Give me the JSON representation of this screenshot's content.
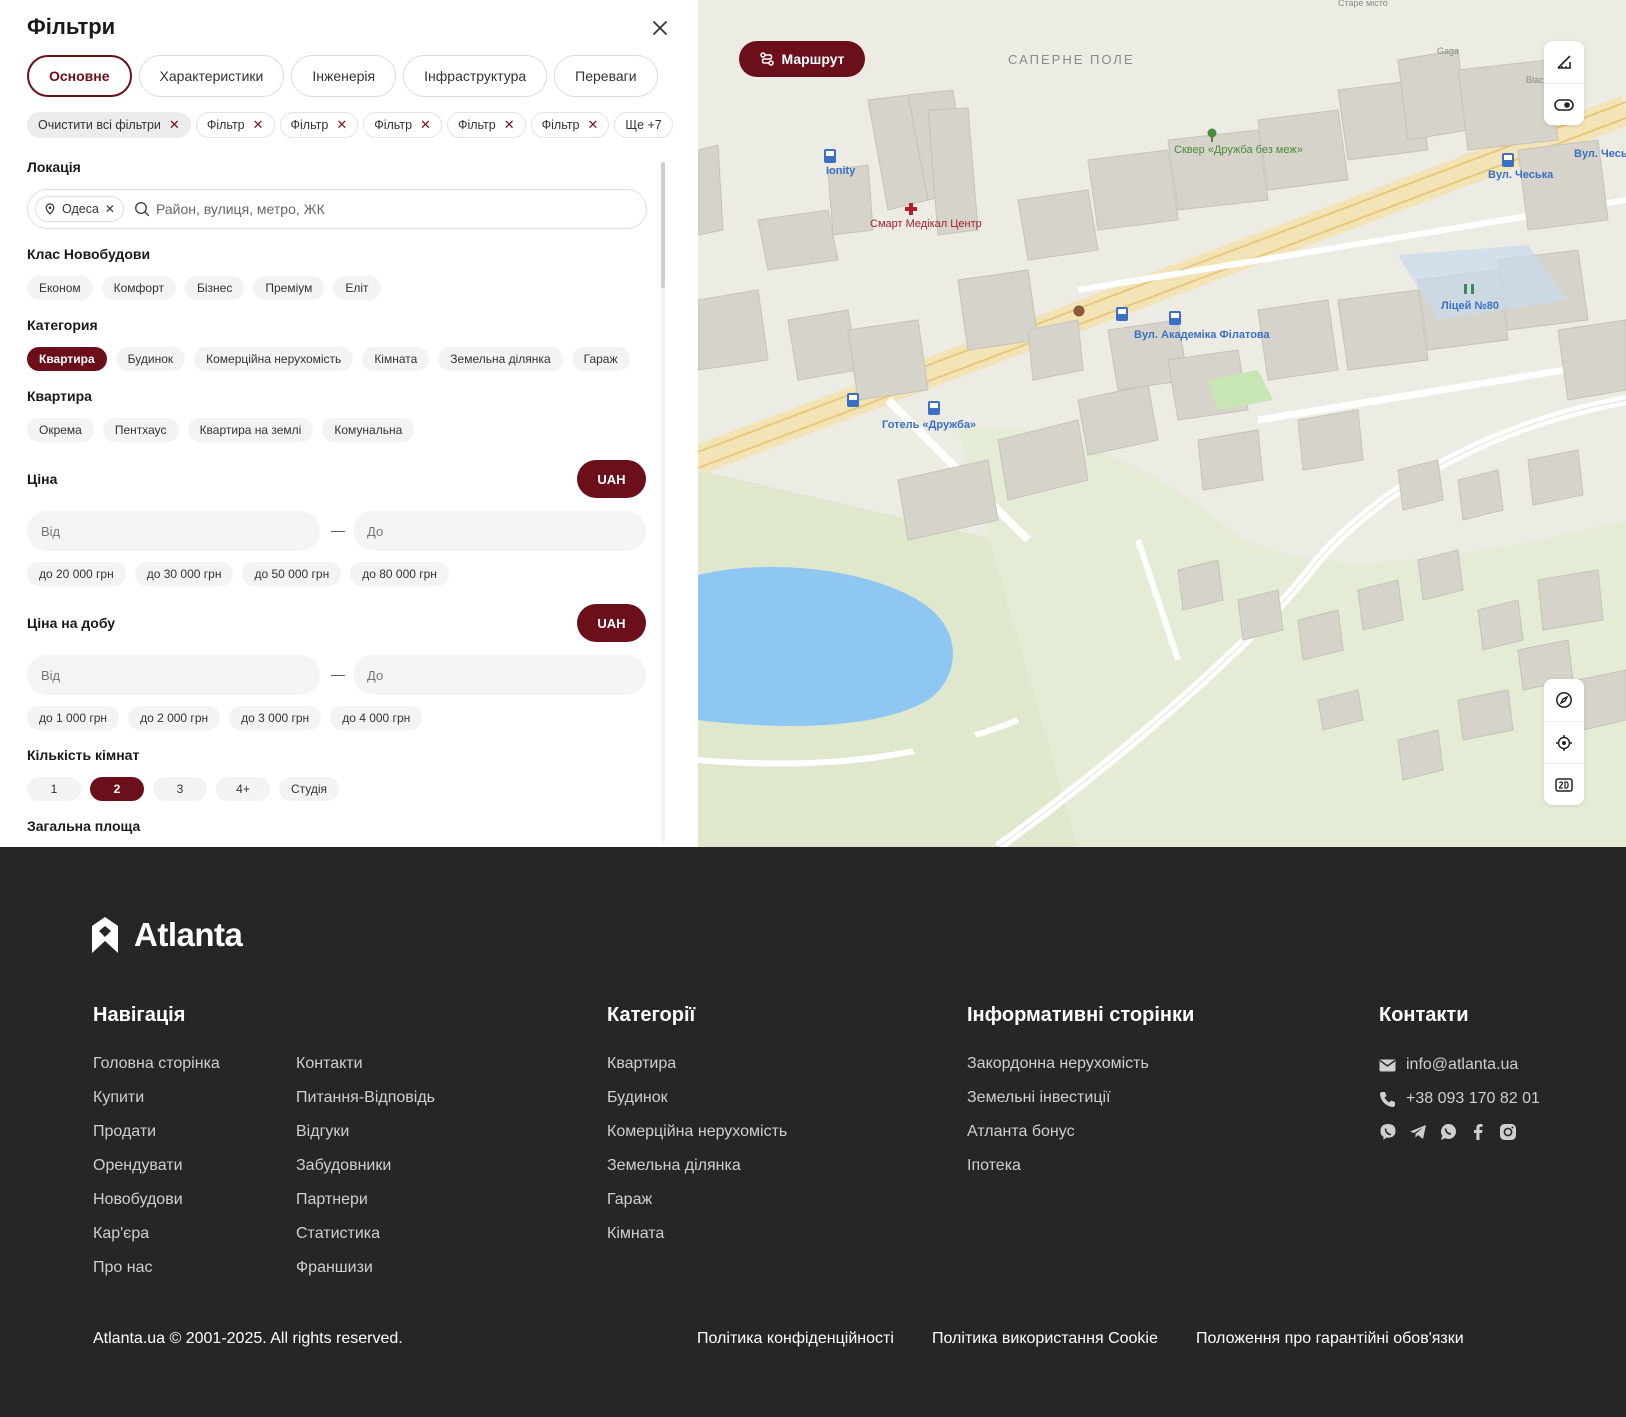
{
  "filters": {
    "title": "Фільтри",
    "tabs": [
      "Основне",
      "Характеристики",
      "Інженерія",
      "Інфраструктура",
      "Переваги"
    ],
    "chips": {
      "clear": "Очистити всі фільтри",
      "items": [
        "Фільтр",
        "Фільтр",
        "Фільтр",
        "Фільтр",
        "Фільтр"
      ],
      "more": "Ще +7"
    },
    "location": {
      "label": "Локація",
      "city": "Одеса",
      "placeholder": "Район, вулиця, метро, ЖК"
    },
    "class": {
      "label": "Клас Новобудови",
      "options": [
        "Економ",
        "Комфорт",
        "Бізнес",
        "Преміум",
        "Еліт"
      ]
    },
    "category": {
      "label": "Категория",
      "options": [
        "Квартира",
        "Будинок",
        "Комерційна нерухомість",
        "Кімната",
        "Земельна ділянка",
        "Гараж"
      ],
      "selected": "Квартира"
    },
    "apartment": {
      "label": "Квартира",
      "options": [
        "Окрема",
        "Пентхаус",
        "Квартира на землі",
        "Комунальна"
      ]
    },
    "price": {
      "label": "Ціна",
      "currency": "UAH",
      "from_placeholder": "Від",
      "to_placeholder": "До",
      "presets": [
        "до 20 000 грн",
        "до 30 000 грн",
        "до 50 000 грн",
        "до 80 000 грн"
      ]
    },
    "daily_price": {
      "label": "Ціна на добу",
      "currency": "UAH",
      "from_placeholder": "Від",
      "to_placeholder": "До",
      "presets": [
        "до 1 000 грн",
        "до 2 000 грн",
        "до 3 000 грн",
        "до 4 000 грн"
      ]
    },
    "rooms": {
      "label": "Кількість кімнат",
      "options": [
        "1",
        "2",
        "3",
        "4+",
        "Студія"
      ],
      "selected": "2"
    },
    "area": {
      "label": "Загальна площа"
    },
    "dash": "—"
  },
  "map": {
    "route_label": "Маршрут",
    "labels": {
      "district": "САПЕРНЕ ПОЛЕ",
      "ionity": "Ionity",
      "clinic": "Смарт Медікал Центр",
      "square": "Сквер «Дружба без меж»",
      "lyceum": "Ліцей №80",
      "stop1": "Вул. Академіка Філатова",
      "hotel": "Готель «Дружба»",
      "stop2": "Вул. Чеська",
      "stop3": "Вул. Чеськ",
      "gaga": "Gaga",
      "old_city": "Старе місто",
      "blac": "Blac"
    }
  },
  "footer": {
    "logo": "Atlanta",
    "nav": {
      "title": "Навігація",
      "col1": [
        "Головна сторінка",
        "Купити",
        "Продати",
        "Орендувати",
        "Новобудови",
        "Кар'єра",
        "Про нас"
      ],
      "col2": [
        "Контакти",
        "Питання-Відповідь",
        "Відгуки",
        "Забудовники",
        "Партнери",
        "Статистика",
        "Франшизи"
      ]
    },
    "categories": {
      "title": "Категорії",
      "items": [
        "Квартира",
        "Будинок",
        "Комерційна нерухомість",
        "Земельна ділянка",
        "Гараж",
        "Кімната"
      ]
    },
    "info": {
      "title": "Інформативні сторінки",
      "items": [
        "Закордонна нерухомість",
        "Земельні інвестиції",
        "Атланта бонус",
        "Іпотека"
      ]
    },
    "contacts": {
      "title": "Контакти",
      "email": "info@atlanta.ua",
      "phone": "+38 093 170 82 01"
    },
    "copyright": "Atlanta.ua © 2001-2025. All rights reserved.",
    "legal": [
      "Політика конфіденційності",
      "Політика використання Cookie",
      "Положення про гарантійні обов'язки"
    ]
  },
  "colors": {
    "brand": "#6b0f1a",
    "footer_bg": "#262626",
    "water": "#8ec8f2",
    "park": "#dde8c8"
  }
}
